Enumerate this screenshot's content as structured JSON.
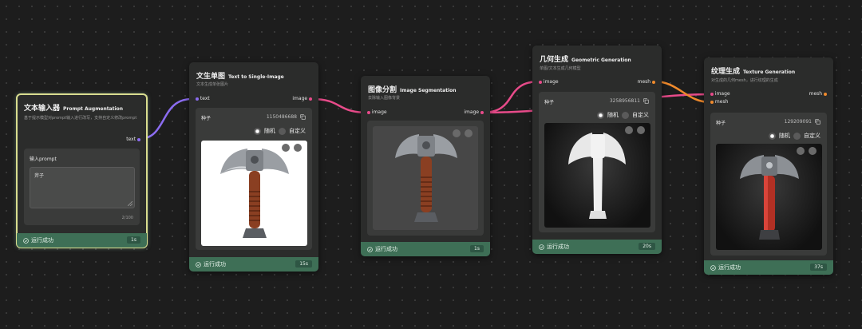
{
  "nodes": {
    "prompt": {
      "title": "文本输入器",
      "title_en": "Prompt Augmentation",
      "desc": "基于提示模型对prompt输入进行改写，支持自定义修改prompt",
      "out_port": "text",
      "input_label": "输入prompt",
      "input_value": "斧子",
      "counter": "2/100",
      "status": "运行成功",
      "time": "1s"
    },
    "t2i": {
      "title": "文生单图",
      "title_en": "Text to Single-Image",
      "desc": "文本生成单张图片",
      "in_port": "text",
      "out_port": "image",
      "seed_label": "种子",
      "seed_value": "1150486688",
      "opt_random": "随机",
      "opt_custom": "自定义",
      "status": "运行成功",
      "time": "15s"
    },
    "seg": {
      "title": "图像分割",
      "title_en": "Image Segmentation",
      "desc": "去除输入图像背景",
      "in_port": "image",
      "out_port": "image",
      "status": "运行成功",
      "time": "1s"
    },
    "geo": {
      "title": "几何生成",
      "title_en": "Geometric Generation",
      "desc": "单图/文本生成几何模型",
      "in_port": "image",
      "out_port": "mesh",
      "seed_label": "种子",
      "seed_value": "3258956811",
      "opt_random": "随机",
      "opt_custom": "自定义",
      "status": "运行成功",
      "time": "20s"
    },
    "tex": {
      "title": "纹理生成",
      "title_en": "Texture Generation",
      "desc": "对生成的几何mesh，进行纹理的生成",
      "in_port_image": "image",
      "in_port_mesh": "mesh",
      "out_port": "mesh",
      "seed_label": "种子",
      "seed_value": "129209091",
      "opt_random": "随机",
      "opt_custom": "自定义",
      "status": "运行成功",
      "time": "37s"
    }
  },
  "colors": {
    "edge_text": "#8b6cf0",
    "edge_image": "#e84b8a",
    "edge_mesh": "#f08a2c",
    "footer_success": "#3e6f56",
    "selected_border": "#d9dd8f"
  },
  "icons": [
    "check-circle-icon",
    "copy-icon",
    "download-icon",
    "expand-icon",
    "resize-handle-icon"
  ]
}
